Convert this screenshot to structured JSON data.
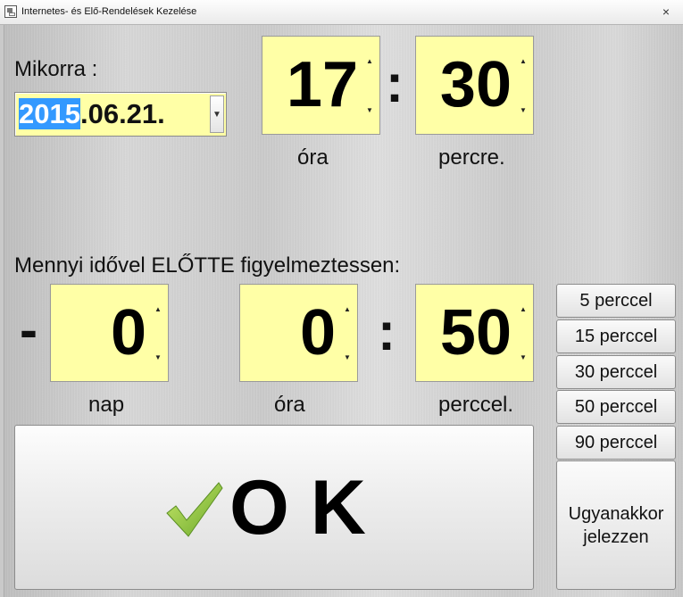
{
  "window": {
    "title": "Internetes- és Elő-Rendelések Kezelése",
    "close_glyph": "×"
  },
  "when": {
    "label": "Mikorra :",
    "date_year": "2015",
    "date_rest": ".06.21.",
    "hour": "17",
    "minute": "30",
    "hour_label": "óra",
    "minute_label": "percre.",
    "separator": ":"
  },
  "advance": {
    "label": "Mennyi idővel ELŐTTE figyelmeztessen:",
    "minus": "-",
    "days": "0",
    "hours": "0",
    "minutes": "50",
    "days_label": "nap",
    "hours_label": "óra",
    "minutes_label": "perccel.",
    "separator": ":"
  },
  "presets": [
    "5 perccel",
    "15 perccel",
    "30 perccel",
    "50 perccel",
    "90 perccel"
  ],
  "same_time": {
    "line1": "Ugyanakkor",
    "line2": "jelezzen"
  },
  "ok_button": {
    "label": "O K",
    "icon": "checkmark-icon"
  },
  "spinner": {
    "up_glyph": "▲",
    "down_glyph": "▼"
  },
  "colors": {
    "field_bg": "#ffffa6",
    "selection": "#3399ff",
    "check_green": "#8cc63f"
  }
}
